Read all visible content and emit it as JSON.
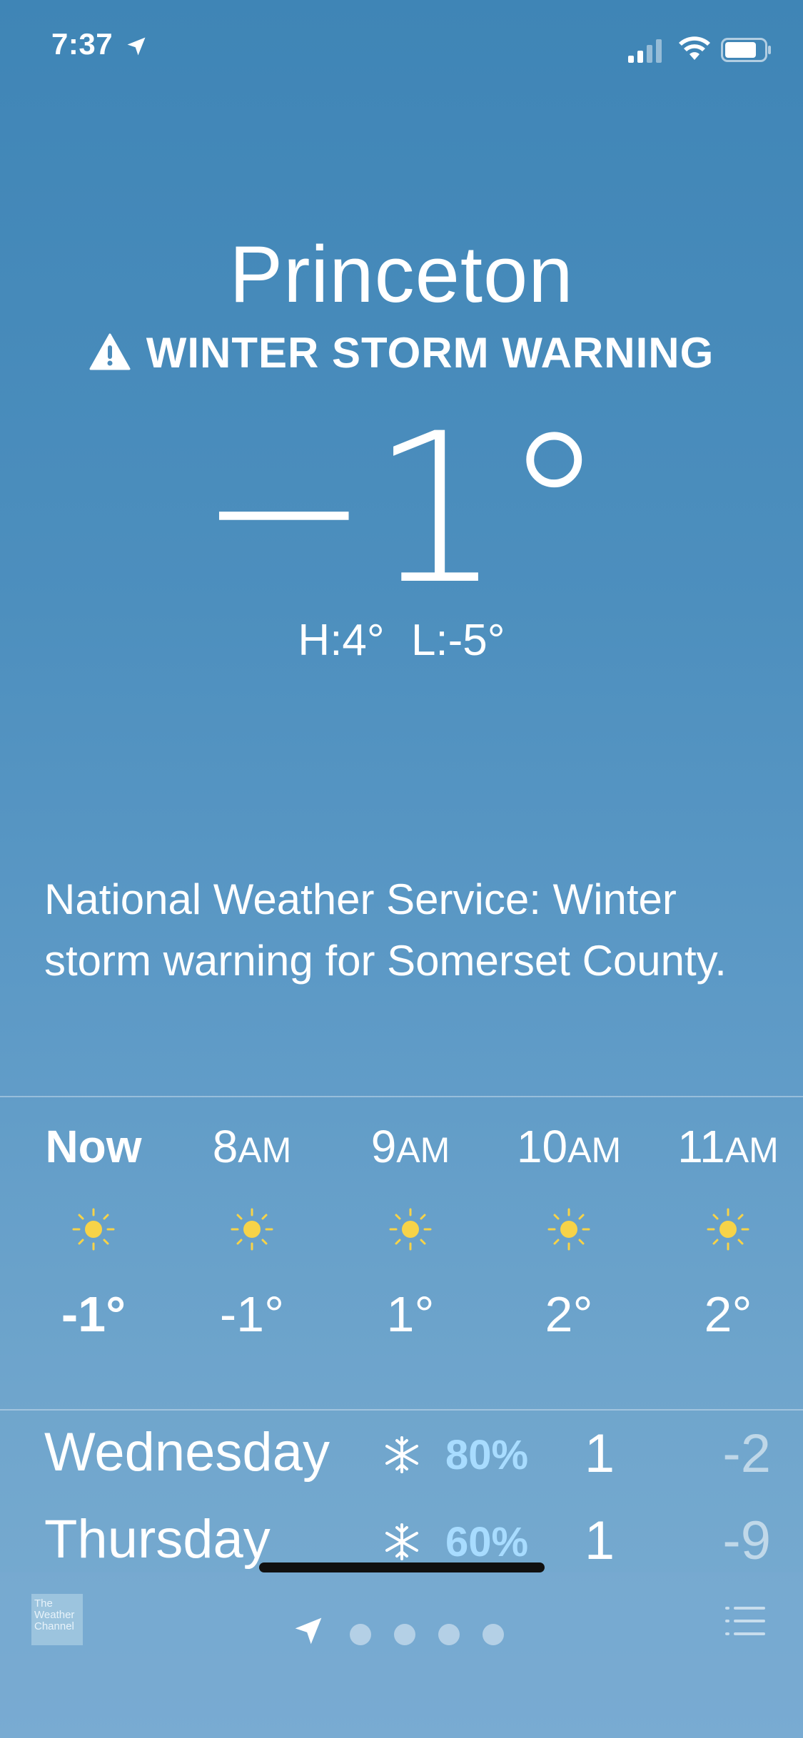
{
  "status_bar": {
    "time": "7:37"
  },
  "weather": {
    "city": "Princeton",
    "warning": "WINTER STORM WARNING",
    "temperature": "−1°",
    "high": "H:4°",
    "low": "L:-5°",
    "alert": "National Weather Service: Winter storm warning for Somerset County."
  },
  "hourly": [
    {
      "hour": "Now",
      "ampm": "",
      "icon": "sun-icon",
      "temp": "-1°"
    },
    {
      "hour": "8",
      "ampm": "AM",
      "icon": "sun-icon",
      "temp": "-1°"
    },
    {
      "hour": "9",
      "ampm": "AM",
      "icon": "sun-icon",
      "temp": "1°"
    },
    {
      "hour": "10",
      "ampm": "AM",
      "icon": "sun-icon",
      "temp": "2°"
    },
    {
      "hour": "11",
      "ampm": "AM",
      "icon": "sun-icon",
      "temp": "2°"
    }
  ],
  "daily": [
    {
      "day": "Wednesday",
      "icon": "snowflake-icon",
      "precip": "80%",
      "high": "1",
      "low": "-2"
    },
    {
      "day": "Thursday",
      "icon": "snowflake-icon",
      "precip": "60%",
      "high": "1",
      "low": "-9"
    }
  ],
  "bottom_bar": {
    "logo_text": "The Weather Channel",
    "page_count": 4,
    "current_page_icon": "location-arrow-icon",
    "list_icon": "list-icon"
  },
  "colors": {
    "background_top": "#3f85b6",
    "background_bottom": "#7aadd2",
    "sun": "#f7d348",
    "precip": "#a8dcff"
  }
}
